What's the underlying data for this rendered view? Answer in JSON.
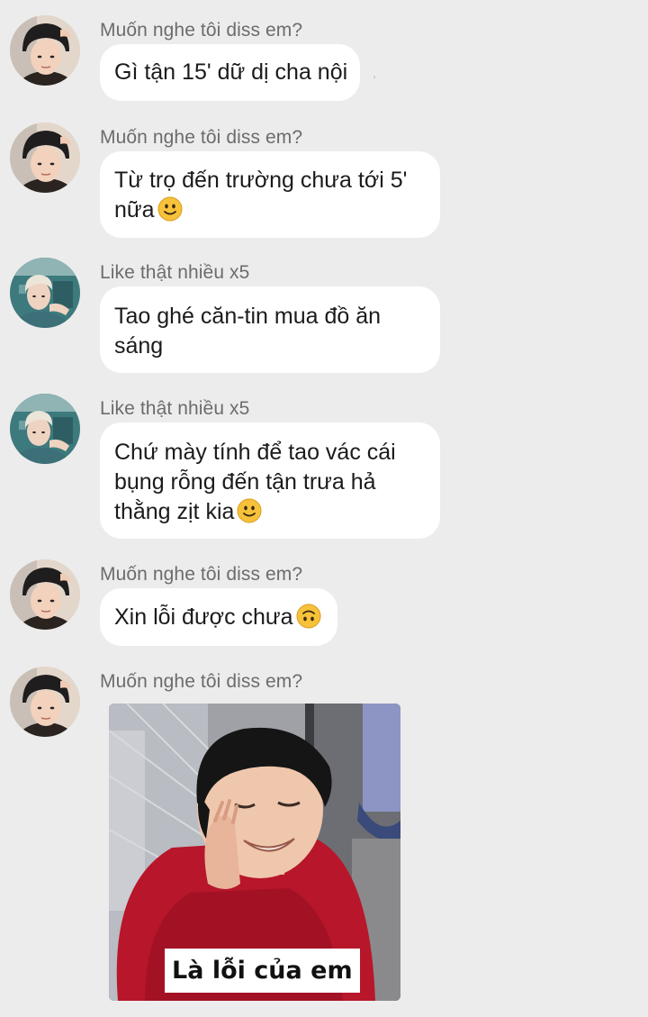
{
  "messages": [
    {
      "sender": "Muốn nghe tôi diss em?",
      "avatar": "avatar-beanie-boy",
      "lines": [
        "Gì tận 15' dữ dị cha nội"
      ],
      "emoji": null
    },
    {
      "sender": "Muốn nghe tôi diss em?",
      "avatar": "avatar-beanie-boy",
      "lines": [
        "Từ trọ đến trường chưa tới 5'",
        "nữa"
      ],
      "emoji": "slightly-smiling-face"
    },
    {
      "sender": "Like thật nhiều x5",
      "avatar": "avatar-blonde-boy",
      "lines": [
        "Tao ghé căn-tin mua đồ ăn",
        "sáng"
      ],
      "emoji": null
    },
    {
      "sender": "Like thật nhiều x5",
      "avatar": "avatar-blonde-boy",
      "lines": [
        "Chứ mày tính để tao vác cái",
        "bụng rỗng đến tận trưa hả",
        "thằng zịt kia"
      ],
      "emoji": "slightly-smiling-face"
    },
    {
      "sender": "Muốn nghe tôi diss em?",
      "avatar": "avatar-beanie-boy",
      "lines": [
        "Xin lỗi được chưa"
      ],
      "emoji": "upside-down-face"
    },
    {
      "sender": "Muốn nghe tôi diss em?",
      "avatar": "avatar-beanie-boy",
      "image_caption": "Là lỗi của em",
      "image": "meme-photo-boy-red-shirt"
    }
  ],
  "colors": {
    "background": "#ececec",
    "bubble": "#ffffff",
    "sender_text": "#6c6c6c",
    "message_text": "#1b1b1b",
    "emoji_yellow": "#f7c23a"
  }
}
